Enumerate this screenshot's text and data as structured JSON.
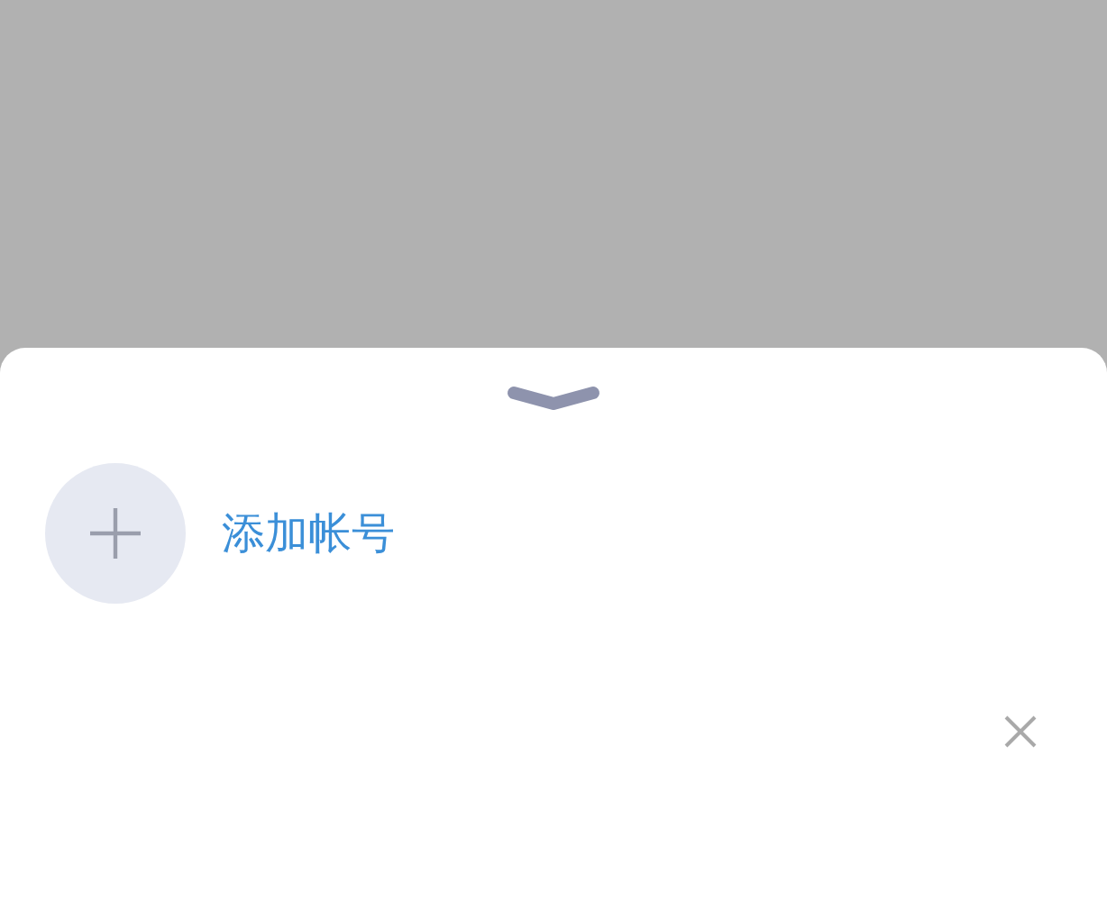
{
  "add_account": {
    "label": "添加帐号"
  }
}
